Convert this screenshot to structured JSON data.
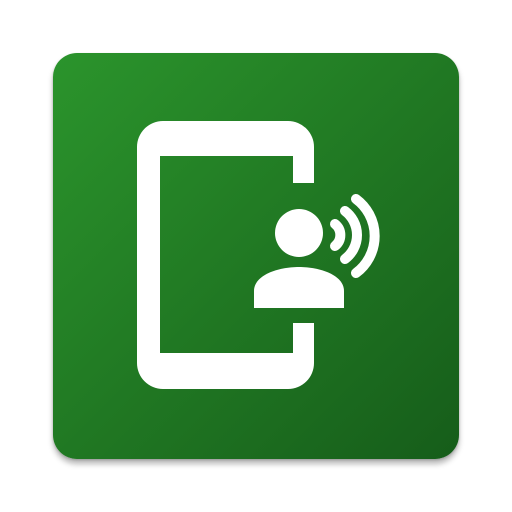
{
  "app_icon": {
    "description_name": "",
    "colors": {
      "gradient_start": "#2b942c",
      "gradient_end": "#165d1a",
      "glyph": "#ffffff"
    },
    "glyph_icons": [
      "phone-outline-icon",
      "person-icon",
      "broadcast-waves-icon"
    ]
  }
}
